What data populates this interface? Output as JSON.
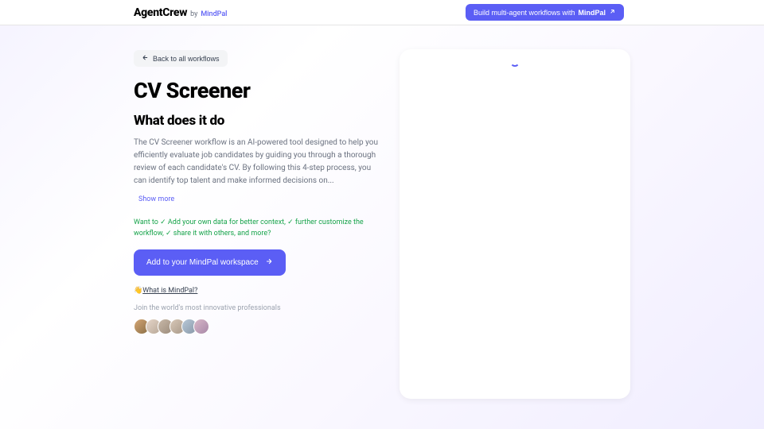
{
  "header": {
    "brand_name": "AgentCrew",
    "brand_by": "by",
    "brand_suffix": "MindPal",
    "cta_prefix": "Build multi-agent workflows with",
    "cta_strong": "MindPal"
  },
  "back": {
    "label": "Back to all workflows"
  },
  "page": {
    "title": "CV Screener",
    "subtitle": "What does it do",
    "description": "The CV Screener workflow is an AI-powered tool designed to help you efficiently evaluate job candidates by guiding you through a thorough review of each candidate's CV. By following this 4-step process, you can identify top talent and make informed decisions on...",
    "show_more": "Show more"
  },
  "want_to": {
    "prefix": "Want to ",
    "item1": "Add your own data for better context, ",
    "item2": "further customize the workflow, ",
    "item3": "share it with others, and more?"
  },
  "add_button": {
    "label": "Add to your MindPal workspace"
  },
  "what_is": {
    "emoji": "👋",
    "link": "What is MindPal?"
  },
  "join": {
    "text": "Join the world's most innovative professionals"
  }
}
